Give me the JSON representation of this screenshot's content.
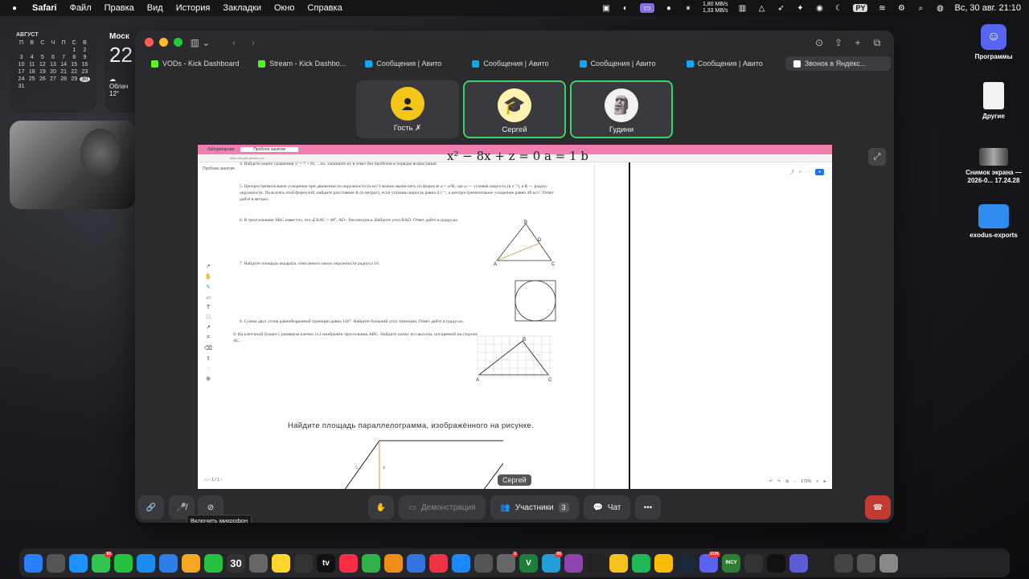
{
  "menubar": {
    "apple": "",
    "app": "Safari",
    "items": [
      "Файл",
      "Правка",
      "Вид",
      "История",
      "Закладки",
      "Окно",
      "Справка"
    ],
    "net_up": "1,80 MB/s",
    "net_down": "1,33 MB/s",
    "input_lang": "PY",
    "datetime": "Вс, 30 авг.  21:10"
  },
  "calendar": {
    "month": "АВГУСТ",
    "weekdays": [
      "П",
      "В",
      "С",
      "Ч",
      "П",
      "С",
      "В"
    ],
    "days": [
      "",
      "",
      "",
      "",
      "",
      "1",
      "2",
      "3",
      "4",
      "5",
      "6",
      "7",
      "8",
      "9",
      "10",
      "11",
      "12",
      "13",
      "14",
      "15",
      "16",
      "17",
      "18",
      "19",
      "20",
      "21",
      "22",
      "23",
      "24",
      "25",
      "26",
      "27",
      "28",
      "29",
      "30",
      "31"
    ],
    "today": "30"
  },
  "weather": {
    "city": "Моск",
    "temp": "22",
    "cond": "Облач",
    "low": "12°"
  },
  "desktop_icons": [
    {
      "label": "Программы",
      "icon": "discord-icon"
    },
    {
      "label": "Другие",
      "icon": "document-icon"
    },
    {
      "label": "Снимок экрана — 2026-0... 17.24.28",
      "icon": "screenshot-icon"
    },
    {
      "label": "exodus-exports",
      "icon": "folder-icon"
    }
  ],
  "tabs": [
    {
      "label": "VODs - Kick Dashboard",
      "icon_color": "#53fc18"
    },
    {
      "label": "Stream - Kick Dashbo...",
      "icon_color": "#53fc18"
    },
    {
      "label": "Сообщения | Авито",
      "icon_color": "#00aaff"
    },
    {
      "label": "Сообщения | Авито",
      "icon_color": "#00aaff"
    },
    {
      "label": "Сообщения | Авито",
      "icon_color": "#00aaff"
    },
    {
      "label": "Сообщения | Авито",
      "icon_color": "#00aaff"
    },
    {
      "label": "Звонок в Яндекс...",
      "icon_color": "#ffffff",
      "active": true
    }
  ],
  "participants": [
    {
      "name": "Гость",
      "muted": true,
      "avatar_color": "#f5c518",
      "speaking": false
    },
    {
      "name": "Сергей",
      "muted": false,
      "avatar_color": "#fff3b0",
      "speaking": true
    },
    {
      "name": "Гудини",
      "muted": false,
      "avatar_color": "#f2f2f2",
      "speaking": true
    }
  ],
  "shared": {
    "header_tabs": [
      "Лабораторная",
      "Пробное занятие"
    ],
    "address": "https://board.yandex.ru/...",
    "lesson_label": "Пробное занятие",
    "formula": "x² − 8x + z = 0   a = 1  b",
    "problems": {
      "p4": "4. Найдите корни уравнения x² = 7 + 8x. ...но, запишите их в ответ без пробелов в порядке возрастания.",
      "p5": "5. Центростремительное ускорение при движении по окружности (в м/с²) можно вычислить по формуле a = ω²R, где ω — угловая скорость (в с⁻¹), а R — радиус окружности. Пользуясь этой формулой, найдите расстояние R (в метрах), если угловая скорость равна 4 с⁻¹, а центростремительное ускорение равно 48 м/с². Ответ дайте в метрах.",
      "p6": "6. В треугольнике ABC известно, что ∠BAC = 48°, AD - биссектриса. Найдите угол BAD. Ответ дайте в градусах.",
      "p7": "7. Найдите площадь квадрата, описанного около окружности радиуса 16.",
      "p8": "8. Сумма двух углов равнобедренной трапеции равна 140°. Найдите больший угол трапеции. Ответ дайте в градусах.",
      "p9": "9. На клетчатой бумаге с размером клетки 1x1 изображён треугольник ABC. Найдите длину его высоты, опущенной на сторону AC."
    },
    "task_title": "Найдите площадь параллелограмма, изображённого на рисунке.",
    "side_a": "5",
    "side_h": "4",
    "page": "1 / 1",
    "zoom": "173%",
    "speaker_label": "Сергей"
  },
  "controls": {
    "demo": "Демонстрация",
    "participants": "Участники",
    "participants_count": "3",
    "chat": "Чат",
    "tooltip": "Включить микрофон"
  },
  "dock": {
    "date_num": "30",
    "apps": [
      {
        "name": "finder",
        "color": "#2a7fff"
      },
      {
        "name": "launchpad",
        "color": "#555"
      },
      {
        "name": "safari",
        "color": "#1e90ff"
      },
      {
        "name": "messages",
        "color": "#31c451",
        "badge": "93"
      },
      {
        "name": "facetime",
        "color": "#25c13f"
      },
      {
        "name": "app-store",
        "color": "#1c8cf0"
      },
      {
        "name": "mail",
        "color": "#2f7ee8"
      },
      {
        "name": "photos",
        "color": "#f5a623"
      },
      {
        "name": "phone",
        "color": "#25c13f"
      },
      {
        "name": "calendar",
        "color": "#333"
      },
      {
        "name": "system",
        "color": "#666"
      },
      {
        "name": "notes",
        "color": "#ffd52e"
      },
      {
        "name": "reminders",
        "color": "#333"
      },
      {
        "name": "tv",
        "color": "#111",
        "label": "tv"
      },
      {
        "name": "music",
        "color": "#fa2d48"
      },
      {
        "name": "numbers",
        "color": "#2fb34a"
      },
      {
        "name": "pages",
        "color": "#f08c1a"
      },
      {
        "name": "keynote",
        "color": "#3474e0"
      },
      {
        "name": "tool",
        "color": "#e34"
      },
      {
        "name": "preview",
        "color": "#1e88ff"
      },
      {
        "name": "xcode",
        "color": "#555"
      },
      {
        "name": "maps",
        "color": "#666",
        "badge": "3"
      },
      {
        "name": "vim",
        "color": "#1e7d3a",
        "label": "V"
      },
      {
        "name": "telegram",
        "color": "#229ed9",
        "badge": "65"
      },
      {
        "name": "vpn",
        "color": "#8e44ad"
      },
      {
        "name": "terminal",
        "color": "#222"
      },
      {
        "name": "notes2",
        "color": "#f7c11e"
      },
      {
        "name": "spotify",
        "color": "#1db954"
      },
      {
        "name": "chrome",
        "color": "#fbbc04"
      },
      {
        "name": "steam",
        "color": "#1b2838"
      },
      {
        "name": "discord",
        "color": "#5865f2",
        "badge": "1126"
      },
      {
        "name": "incy",
        "color": "#2e7d32",
        "label": "INCY"
      },
      {
        "name": "activity",
        "color": "#333"
      },
      {
        "name": "vnn",
        "color": "#111"
      },
      {
        "name": "folder1",
        "color": "#5b5bd6"
      },
      {
        "name": "folder2",
        "color": "#222"
      },
      {
        "name": "folder3",
        "color": "#444"
      },
      {
        "name": "folder4",
        "color": "#555"
      },
      {
        "name": "trash",
        "color": "#888"
      }
    ]
  }
}
